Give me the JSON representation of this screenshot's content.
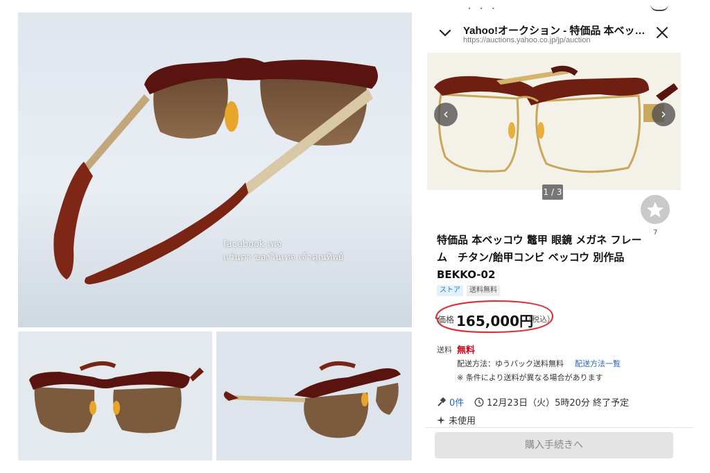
{
  "watermark": {
    "line1": "facebook เพจ",
    "line2": "แว่นตา ของวินเทจ เจ้าคุณทิพย์"
  },
  "header": {
    "top_fragment": "・ ・ ・",
    "title": "Yahoo!オークション - 特価品 本ベッ…",
    "url": "https://auctions.yahoo.co.jp/jp/auction"
  },
  "carousel": {
    "prev_glyph": "‹",
    "next_glyph": "›",
    "counter": "1 / 3"
  },
  "watch": {
    "count": "7"
  },
  "item": {
    "title": "特価品 本ベッコウ 鼈甲 眼鏡 メガネ フレーム　チタン/飴甲コンビ ベッコウ 別作品　BEKKO-02",
    "tags": [
      "ストア",
      "送料無料"
    ]
  },
  "price": {
    "label": "価格",
    "value": "165,000円",
    "tax": "（税込）"
  },
  "shipping": {
    "label": "送料",
    "value": "無料",
    "method": "配送方法：ゆうパック送料無料",
    "link": "配送方法一覧",
    "note": "※ 条件により送料が異なる場合があります"
  },
  "meta": {
    "bids": "0件",
    "end_time": "12月23日（火）5時20分 終了予定",
    "condition": "未使用"
  },
  "buy_button": "購入手続きへ",
  "colors": {
    "accent_red": "#d0021b",
    "link_blue": "#1f66c1",
    "oval_red": "#d9363b",
    "tortoise": "#6e1f12"
  }
}
